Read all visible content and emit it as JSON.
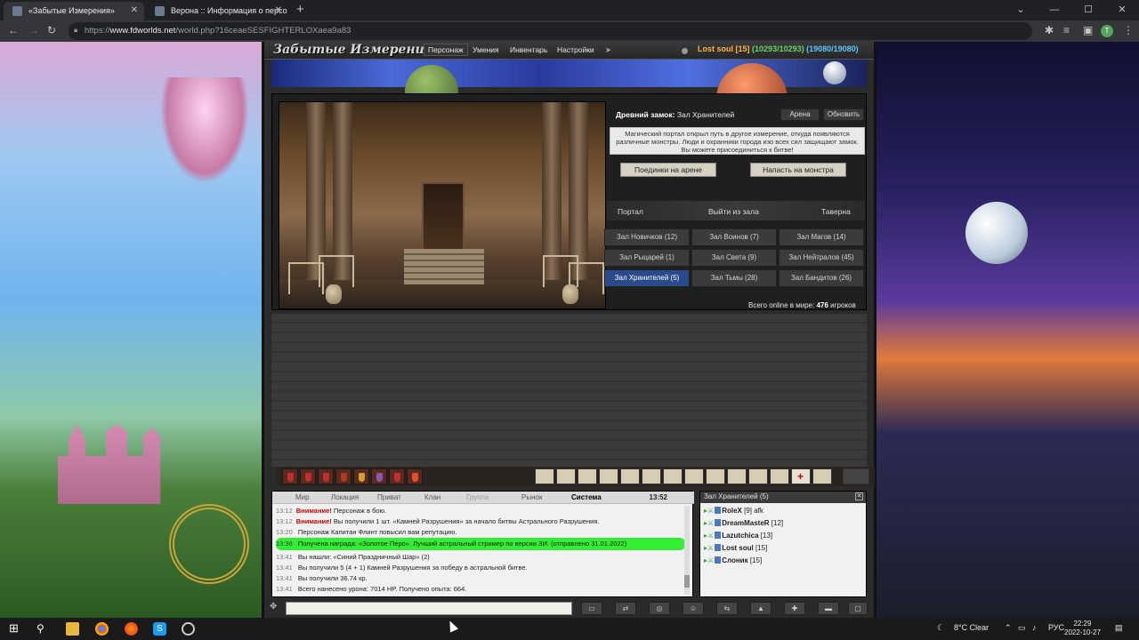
{
  "browser": {
    "tabs": [
      {
        "title": "«Забытые Измерения»",
        "active": true
      },
      {
        "title": "Верона :: Информация о персо",
        "active": false
      }
    ],
    "url_prefix": "https://",
    "url_domain": "www.fdworlds.net",
    "url_path": "/world.php?16ceaeSESFIGHTERLOXaea9a83",
    "profile_initial": "T"
  },
  "game": {
    "logo": "Забытые Измерения",
    "nav": [
      "Персонаж",
      "Умения",
      "Инвентарь",
      "Настройки"
    ],
    "player_name": "Lost soul",
    "player_level": "[15]",
    "hp": "(10293/10293)",
    "mp": "(19080/19080)",
    "location_prefix": "Древний замок:",
    "location_name": "Зал Хранителей",
    "arena_label": "Арена",
    "refresh_label": "Обновить",
    "info_text": "Магический портал открыл путь в другое измерение, откуда появляются различные монстры. Люди и охранники города изо всех сил защищают замок. Вы можете присоединиться к битве!",
    "action_duels": "Поединки на арене",
    "action_attack": "Напасть на монстра",
    "links": [
      "Портал",
      "Выйти из зала",
      "Таверна"
    ],
    "halls": [
      {
        "label": "Зал Новичков (12)",
        "active": false
      },
      {
        "label": "Зал Воинов (7)",
        "active": false
      },
      {
        "label": "Зал Магов (14)",
        "active": false
      },
      {
        "label": "Зал Рыцарей (1)",
        "active": false
      },
      {
        "label": "Зал Света (9)",
        "active": false
      },
      {
        "label": "Зал Нейтралов (45)",
        "active": false
      },
      {
        "label": "Зал Хранителей (5)",
        "active": true
      },
      {
        "label": "Зал Тьмы (28)",
        "active": false
      },
      {
        "label": "Зал Бандитов (26)",
        "active": false
      }
    ],
    "online_prefix": "Всего online в мире:",
    "online_count": "476",
    "online_suffix": "игроков"
  },
  "chat": {
    "tabs": [
      "Мир",
      "Локация",
      "Приват",
      "Клан",
      "Группа",
      "Рынок",
      "Система"
    ],
    "active_tab": "Система",
    "time": "13:52",
    "lines": [
      {
        "t": "13:12",
        "warn": "Внимание!",
        "text": "Персонаж в бою."
      },
      {
        "t": "13:12",
        "warn": "Внимание!",
        "text": "Вы получили 1 шт. «Камней Разрушения» за начало битвы Астрального Разрушения."
      },
      {
        "t": "13:20",
        "warn": "",
        "text": "Персонаж Капитан Флинт повысил вам репутацию."
      },
      {
        "t": "13:36",
        "warn": "",
        "text": "Получена награда: «Золотое Перо». Лучший астральный стример по версии ЗИ. (отправлено 31.01.2022)",
        "hl": true
      },
      {
        "t": "13:41",
        "warn": "",
        "text": "Вы нашли: «Синий Праздничный Шар» (2)"
      },
      {
        "t": "13:41",
        "warn": "",
        "text": "Вы получили 5 (4 + 1) Камней Разрушения за победу в астральной битве."
      },
      {
        "t": "13:41",
        "warn": "",
        "text": "Вы получили 36.74 кр."
      },
      {
        "t": "13:41",
        "warn": "",
        "text": "Всего нанесено урона: 7014 HP. Получено опыта: 664."
      }
    ]
  },
  "players": {
    "title": "Зал Хранителей (5)",
    "list": [
      {
        "name": "RoleX",
        "lvl": "[9]",
        "note": "afk"
      },
      {
        "name": "DreamMasteR",
        "lvl": "[12]",
        "note": ""
      },
      {
        "name": "Lazutchica",
        "lvl": "[13]",
        "note": ""
      },
      {
        "name": "Lost soul",
        "lvl": "[15]",
        "note": ""
      },
      {
        "name": "Слоник",
        "lvl": "[15]",
        "note": ""
      }
    ]
  },
  "taskbar": {
    "weather": "8°C  Clear",
    "lang": "РУС",
    "time": "22:29",
    "date": "2022-10-27"
  }
}
